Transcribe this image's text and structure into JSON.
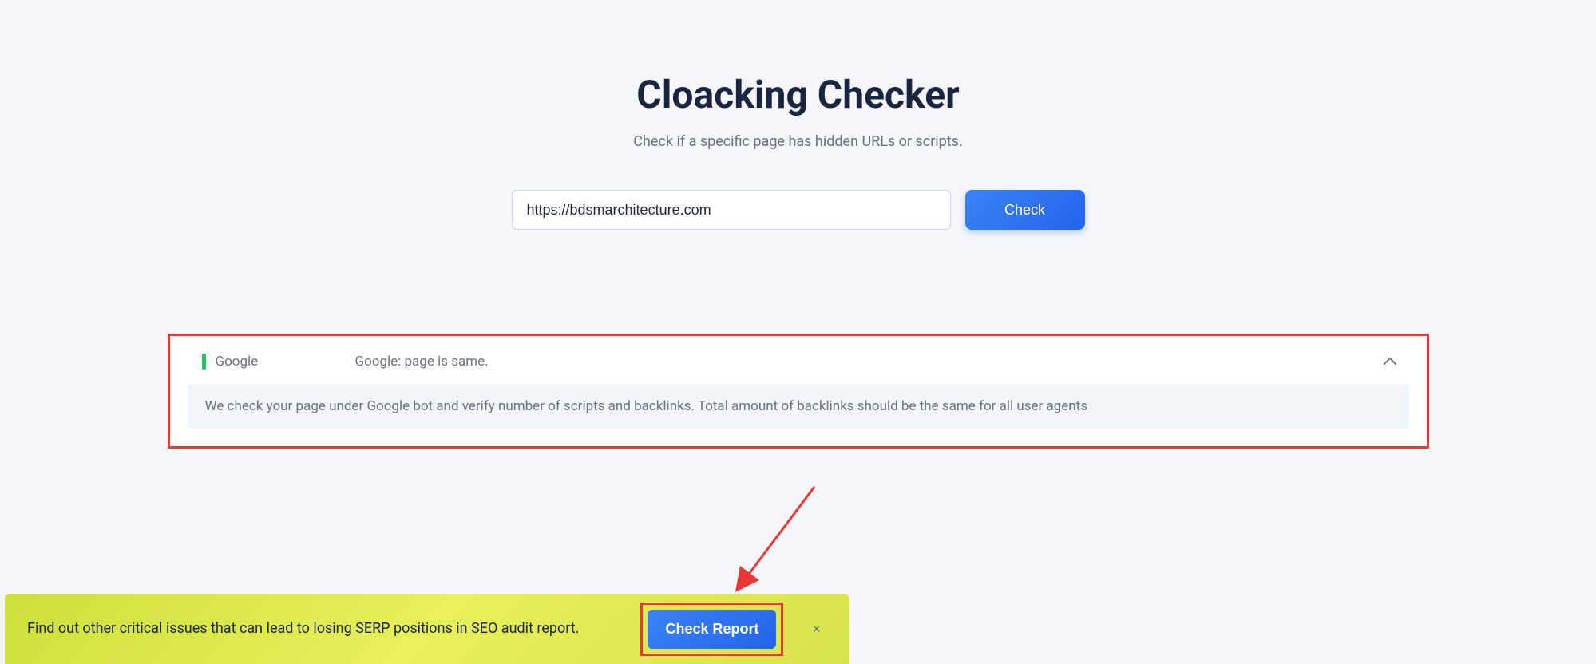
{
  "header": {
    "title": "Cloacking Checker",
    "subtitle": "Check if a specific page has hidden URLs or scripts."
  },
  "search": {
    "value": "https://bdsmarchitecture.com",
    "placeholder": "Enter URL",
    "button_label": "Check"
  },
  "result": {
    "source": "Google",
    "message": "Google: page is same.",
    "status": "ok",
    "detail": "We check your page under Google bot and verify number of scripts and backlinks. Total amount of backlinks should be the same for all user agents"
  },
  "banner": {
    "text": "Find out other critical issues that can lead to losing SERP positions in SEO audit report.",
    "button_label": "Check Report",
    "close_label": "×"
  },
  "colors": {
    "accent_blue": "#2563eb",
    "annotation_red": "#e53935",
    "status_green": "#22c55e",
    "banner_bg": "#d5e34a"
  }
}
